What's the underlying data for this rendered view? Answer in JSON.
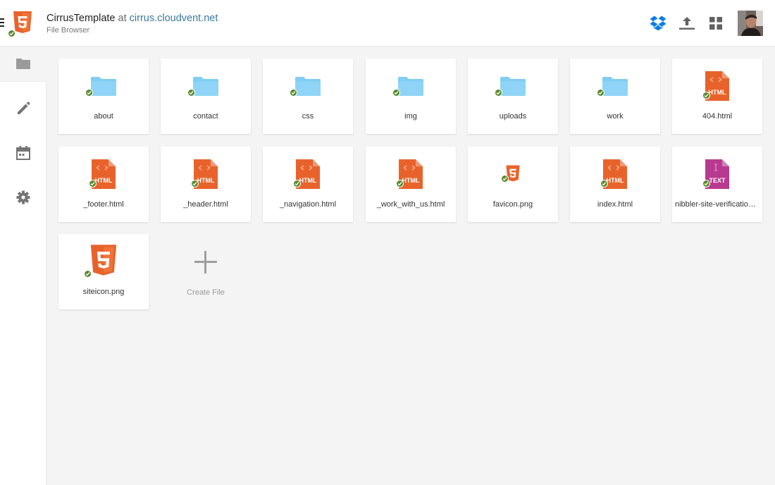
{
  "header": {
    "project": "CirrusTemplate",
    "at": "at",
    "host": "cirrus.cloudvent.net",
    "subtitle": "File Browser"
  },
  "icons": {
    "brand": "html5-logo",
    "dropbox": "dropbox-icon",
    "upload": "upload-icon",
    "apps": "grid-icon",
    "avatar": "user-avatar"
  },
  "colors": {
    "html_orange": "#e8632b",
    "folder_blue": "#81cdf3",
    "text_purple": "#b83a8f",
    "sync_green": "#5a8a2d",
    "link_blue": "#39799b",
    "dropbox_blue": "#0d7ee5"
  },
  "sidebar": {
    "items": [
      {
        "name": "files",
        "icon": "folder-icon",
        "active": true
      },
      {
        "name": "edit",
        "icon": "pencil-icon",
        "active": false
      },
      {
        "name": "calendar",
        "icon": "calendar-icon",
        "active": false
      },
      {
        "name": "settings",
        "icon": "gear-icon",
        "active": false
      }
    ]
  },
  "files": [
    {
      "label": "about",
      "type": "folder"
    },
    {
      "label": "contact",
      "type": "folder"
    },
    {
      "label": "css",
      "type": "folder"
    },
    {
      "label": "img",
      "type": "folder"
    },
    {
      "label": "uploads",
      "type": "folder"
    },
    {
      "label": "work",
      "type": "folder"
    },
    {
      "label": "404.html",
      "type": "html",
      "badge": "HTML"
    },
    {
      "label": "_footer.html",
      "type": "html",
      "badge": "HTML"
    },
    {
      "label": "_header.html",
      "type": "html",
      "badge": "HTML"
    },
    {
      "label": "_navigation.html",
      "type": "html",
      "badge": "HTML"
    },
    {
      "label": "_work_with_us.html",
      "type": "html",
      "badge": "HTML"
    },
    {
      "label": "favicon.png",
      "type": "image-small"
    },
    {
      "label": "index.html",
      "type": "html",
      "badge": "HTML"
    },
    {
      "label": "nibbler-site-verification.txt",
      "type": "text",
      "badge": "TEXT"
    },
    {
      "label": "siteicon.png",
      "type": "image-large"
    }
  ],
  "create_file_label": "Create File"
}
